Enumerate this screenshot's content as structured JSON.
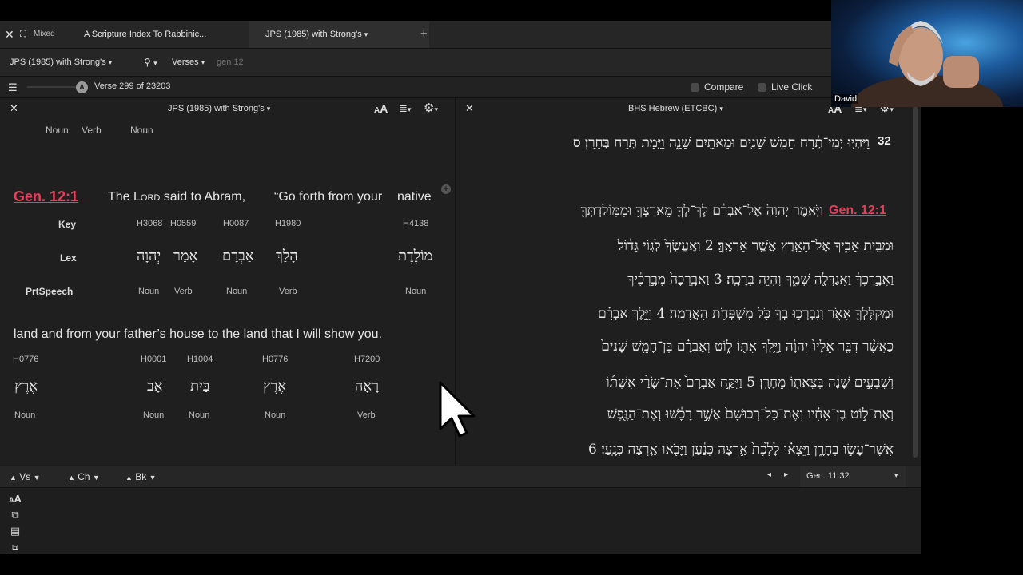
{
  "tabs": {
    "mixed_label": "Mixed",
    "tab1": "A Scripture Index To Rabbinic...",
    "tab2": "JPS (1985) with Strong's",
    "tab2_arrow": "▾",
    "add": "+"
  },
  "toolbar": {
    "resource": "JPS (1985) with Strong's",
    "search_icon": "search-icon",
    "mode": "Verses",
    "query": "gen 12"
  },
  "progress": {
    "badge": "A",
    "label": "Verse 299 of 23203",
    "fraction": 0.013
  },
  "right_controls": {
    "compare": "Compare",
    "live_click": "Live Click"
  },
  "left_panel": {
    "title": "JPS (1985) with Strong's",
    "font_btn": "AA",
    "prev_pos": [
      "Noun",
      "Verb",
      "Noun"
    ],
    "verse_ref": "Gen. 12:1",
    "line1": [
      {
        "text": "The "
      },
      {
        "text": "Lord"
      },
      {
        "text": " said to Abram,"
      },
      {
        "text": "“Go forth from your"
      },
      {
        "text": "native"
      }
    ],
    "row_labels": {
      "key": "Key",
      "lex": "Lex",
      "pos": "PrtSpeech"
    },
    "block1": [
      {
        "key": "H3068",
        "lex": "יְהוָה",
        "pos": "Noun"
      },
      {
        "key": "H0559",
        "lex": "אָמַר",
        "pos": "Verb"
      },
      {
        "key": "H0087",
        "lex": "אַבְרָם",
        "pos": "Noun"
      },
      {
        "key": "H1980",
        "lex": "הָלַךְ",
        "pos": "Verb"
      },
      {
        "key": "H4138",
        "lex": "מוֹלֶדֶת",
        "pos": "Noun"
      }
    ],
    "line2": "land and from your father’s house to the land that I will show you.",
    "block2": [
      {
        "key": "H0776",
        "lex": "אֶרֶץ",
        "pos": "Noun"
      },
      {
        "key": "H0001",
        "lex": "אָב",
        "pos": "Noun"
      },
      {
        "key": "H1004",
        "lex": "בַּיִת",
        "pos": "Noun"
      },
      {
        "key": "H0776",
        "lex": "אֶרֶץ",
        "pos": "Noun"
      },
      {
        "key": "H7200",
        "lex": "רָאָה",
        "pos": "Verb"
      }
    ]
  },
  "right_panel": {
    "title": "BHS Hebrew (ETCBC)",
    "verse_num_32": "32",
    "line_32": "וַיִּהְי֣וּ יְמֵי־תֶ֔רַח חָמֵ֥שׁ שָׁנִ֖ים וּמָאתַ֣יִם שָׁנָ֑ה וַיָּ֥מָת תֶּ֖רַח בְּחָרָֽן׃ ס",
    "verse_ref": "Gen. 12:1",
    "lines": [
      "וַיֹּ֤אמֶר יְהוָה֙ אֶל־אַבְרָ֔ם לֶךְ־לְךָ֛ מֵאַרְצְךָ֥ וּמִמּֽוֹלַדְתְּךָ֖",
      "וּמִבֵּ֣ית אָבִ֑יךָ אֶל־הָאָ֖רֶץ אֲשֶׁ֥ר אַרְאֶֽךָּ׃ 2 וְאֶֽעֶשְׂךָ֙ לְג֣וֹי גָּד֔וֹל",
      "וַאֲבָ֣רֶכְךָ֔ וַאֲגַדְּלָ֖ה שְׁמֶ֑ךָ וֶהְיֵ֖ה בְּרָכָֽה׃ 3 וַאֲבָֽרְכָה֙ מְבָ֣רְכֶ֔יךָ",
      "וּמְקַלֶּלְךָ֖ אָאֹ֑ר וְנִבְרְכ֣וּ בְךָ֔ כֹּ֖ל מִשְׁפְּחֹ֥ת הָאֲדָמָֽה׃ 4 וַיֵּ֣לֶךְ אַבְרָ֗ם",
      "כַּאֲשֶׁ֨ר דִּבֶּ֤ר אֵלָיו֙ יְהוָ֔ה וַיֵּ֥לֶךְ אִתּ֖וֹ ל֑וֹט וְאַבְרָ֗ם בֶּן־חָמֵ֤שׁ שָׁנִים֙",
      "וְשִׁבְעִ֣ים שָׁנָ֔ה בְּצֵאת֖וֹ מֵחָרָֽן׃ 5 וַיִּקַּ֣ח אַבְרָם֩ אֶת־שָׂרַ֨י אִשְׁתּ֜וֹ",
      "וְאֶת־ל֣וֹט בֶּן־אָחִ֗יו וְאֶת־כָּל־רְכוּשָׁם֙ אֲשֶׁ֣ר רָכָ֔שׁוּ וְאֶת־הַנֶּ֖פֶשׁ",
      "אֲשֶׁר־עָשׂ֣וּ בְחָרָ֑ן וַיֵּצְא֗וּ לָלֶ֙כֶת֙ אַ֣רְצָה כְּנַ֔עַן וַיָּבֹ֖אוּ אַ֥רְצָה כְּנָֽעַן׃ 6"
    ]
  },
  "bottom": {
    "vs": "Vs",
    "ch": "Ch",
    "bk": "Bk",
    "location": "Gen. 11:32"
  },
  "video": {
    "name": "David"
  }
}
